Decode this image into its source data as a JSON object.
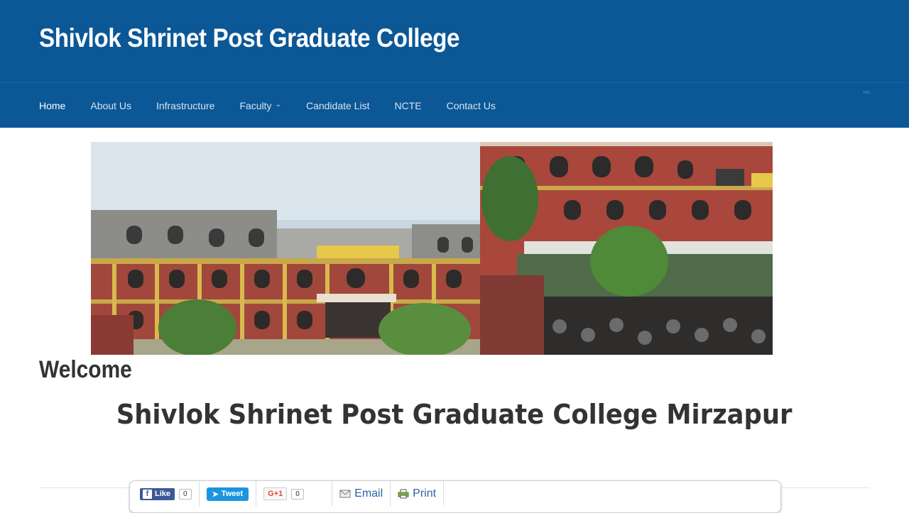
{
  "header": {
    "site_title": "Shivlok Shrinet Post Graduate College"
  },
  "nav": {
    "items": [
      {
        "label": "Home",
        "active": true
      },
      {
        "label": "About Us"
      },
      {
        "label": "Infrastructure"
      },
      {
        "label": "Faculty",
        "has_dropdown": true
      },
      {
        "label": "Candidate List"
      },
      {
        "label": "NCTE"
      },
      {
        "label": "Contact Us"
      }
    ],
    "dropdown_icon": "chevron-down-icon"
  },
  "banner": {
    "alt": "College building photographs"
  },
  "content": {
    "heading": "Welcome",
    "subheading": "Shivlok Shrinet Post Graduate College Mirzapur"
  },
  "share": {
    "facebook_label": "Like",
    "facebook_count": "0",
    "twitter_label": "Tweet",
    "gplus_label": "G+1",
    "gplus_count": "0",
    "email_label": "Email",
    "print_label": "Print"
  },
  "colors": {
    "header_bg": "#0c5796",
    "nav_text": "#d6e4f2",
    "link": "#2b62a8"
  }
}
